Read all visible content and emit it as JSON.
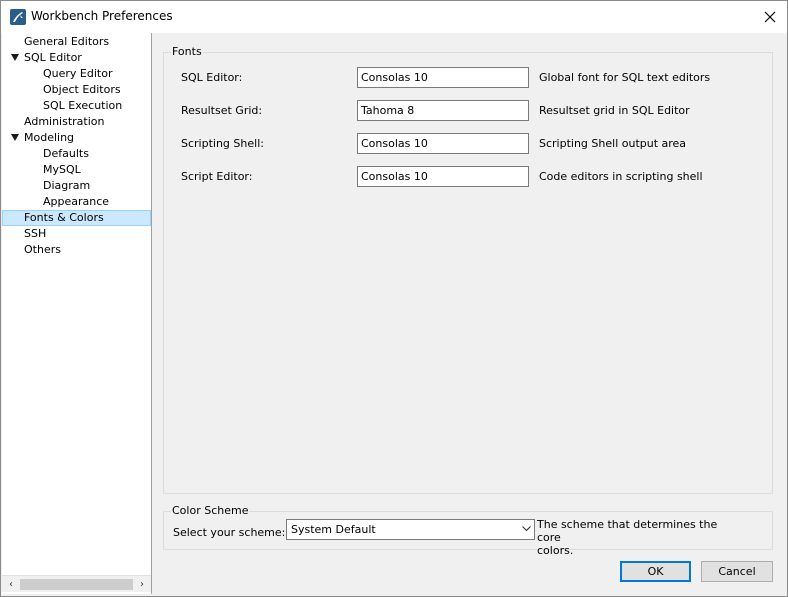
{
  "window": {
    "title": "Workbench Preferences"
  },
  "sidebar": {
    "items": [
      {
        "label": "General Editors",
        "level": 0,
        "expanded": null,
        "selected": false
      },
      {
        "label": "SQL Editor",
        "level": 0,
        "expanded": true,
        "selected": false
      },
      {
        "label": "Query Editor",
        "level": 1,
        "expanded": null,
        "selected": false
      },
      {
        "label": "Object Editors",
        "level": 1,
        "expanded": null,
        "selected": false
      },
      {
        "label": "SQL Execution",
        "level": 1,
        "expanded": null,
        "selected": false
      },
      {
        "label": "Administration",
        "level": 0,
        "expanded": null,
        "selected": false
      },
      {
        "label": "Modeling",
        "level": 0,
        "expanded": true,
        "selected": false
      },
      {
        "label": "Defaults",
        "level": 1,
        "expanded": null,
        "selected": false
      },
      {
        "label": "MySQL",
        "level": 1,
        "expanded": null,
        "selected": false
      },
      {
        "label": "Diagram",
        "level": 1,
        "expanded": null,
        "selected": false
      },
      {
        "label": "Appearance",
        "level": 1,
        "expanded": null,
        "selected": false
      },
      {
        "label": "Fonts & Colors",
        "level": 0,
        "expanded": null,
        "selected": true
      },
      {
        "label": "SSH",
        "level": 0,
        "expanded": null,
        "selected": false
      },
      {
        "label": "Others",
        "level": 0,
        "expanded": null,
        "selected": false
      }
    ],
    "scroll_left_glyph": "‹",
    "scroll_right_glyph": "›"
  },
  "fonts_group": {
    "title": "Fonts",
    "rows": [
      {
        "label": "SQL Editor:",
        "value": "Consolas 10",
        "description": "Global font for SQL text editors"
      },
      {
        "label": "Resultset Grid:",
        "value": "Tahoma 8",
        "description": "Resultset grid in SQL Editor"
      },
      {
        "label": "Scripting Shell:",
        "value": "Consolas 10",
        "description": "Scripting Shell output area"
      },
      {
        "label": "Script Editor:",
        "value": "Consolas 10",
        "description": "Code editors in scripting shell"
      }
    ]
  },
  "color_scheme_group": {
    "title": "Color Scheme",
    "select_label": "Select your scheme:",
    "selected_value": "System Default",
    "description_line1": "The scheme that determines the core",
    "description_line2": "colors."
  },
  "buttons": {
    "ok": "OK",
    "cancel": "Cancel"
  },
  "colors": {
    "selection_bg": "#cce8ff",
    "selection_border": "#99d1ff",
    "default_button_border": "#0078d7",
    "app_icon": "#2a5d8a"
  },
  "icons": {
    "app": "mysql-workbench-dolphin-icon",
    "close": "close-icon",
    "expand": "expanded-triangle-icon",
    "dropdown": "chevron-down-icon"
  }
}
